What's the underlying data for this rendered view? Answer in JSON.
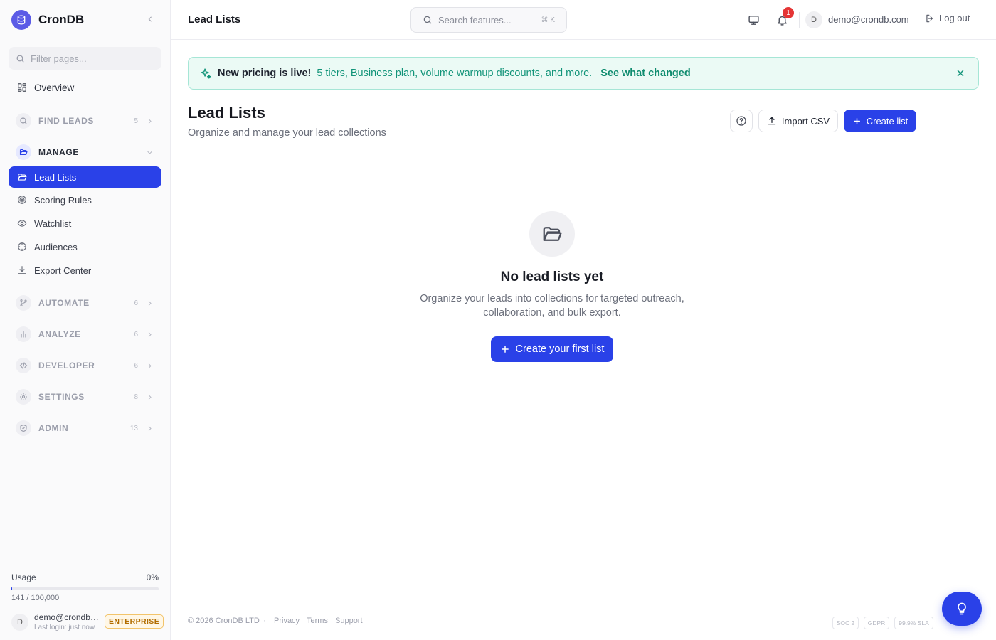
{
  "brand": {
    "name": "CronDB"
  },
  "sidebar": {
    "filter_placeholder": "Filter pages...",
    "overview_label": "Overview",
    "sections": [
      {
        "label": "FIND LEADS",
        "count": "5"
      },
      {
        "label": "MANAGE"
      },
      {
        "label": "AUTOMATE",
        "count": "6"
      },
      {
        "label": "ANALYZE",
        "count": "6"
      },
      {
        "label": "DEVELOPER",
        "count": "6"
      },
      {
        "label": "SETTINGS",
        "count": "8"
      },
      {
        "label": "ADMIN",
        "count": "13"
      }
    ],
    "manage_items": [
      {
        "label": "Lead Lists",
        "active": true
      },
      {
        "label": "Scoring Rules"
      },
      {
        "label": "Watchlist"
      },
      {
        "label": "Audiences"
      },
      {
        "label": "Export Center"
      }
    ],
    "usage": {
      "label": "Usage",
      "percent_text": "0%",
      "fill_fraction": 0.0014,
      "count_text": "141 / 100,000"
    },
    "user": {
      "avatar_initial": "D",
      "email": "demo@crondb.com",
      "last_login": "Last login: just now",
      "plan_badge": "ENTERPRISE"
    }
  },
  "header": {
    "title": "Lead Lists",
    "search_placeholder": "Search features...",
    "search_shortcut": "⌘ K",
    "notification_count": "1",
    "avatar_initial": "D",
    "email": "demo@crondb.com",
    "logout_label": "Log out"
  },
  "banner": {
    "strong": "New pricing is live!",
    "text": "5 tiers, Business plan, volume warmup discounts, and more.",
    "link": "See what changed"
  },
  "page": {
    "title": "Lead Lists",
    "subtitle": "Organize and manage your lead collections",
    "import_label": "Import CSV",
    "create_label": "Create list"
  },
  "empty_state": {
    "title": "No lead lists yet",
    "description": "Organize your leads into collections for targeted outreach, collaboration, and bulk export.",
    "button_label": "Create your first list"
  },
  "footer": {
    "copyright": "© 2026 CronDB LTD",
    "separator": "·",
    "links": [
      "Privacy",
      "Terms",
      "Support"
    ],
    "badges": [
      "SOC 2",
      "GDPR",
      "99.9% SLA"
    ]
  },
  "colors": {
    "accent": "#2a41e8",
    "brand": "#5b5be6",
    "banner_text": "#129479",
    "notification": "#e53535",
    "plan_badge": "#b26d00"
  }
}
